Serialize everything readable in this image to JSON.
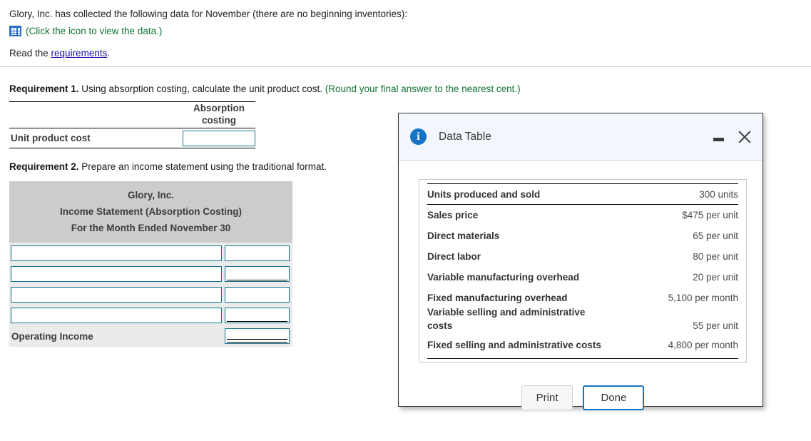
{
  "intro": {
    "line1": "Glory, Inc. has collected the following data for November (there are no beginning inventories):",
    "icon_name": "data-grid-icon",
    "icon_hint": "(Click the icon to view the data.)",
    "read_prefix": "Read the ",
    "read_link": "requirements",
    "read_suffix": "."
  },
  "requirement1": {
    "label": "Requirement 1.",
    "text": " Using absorption costing, calculate the unit product cost. ",
    "hint": "(Round your final answer to the nearest cent.)",
    "column_header_line1": "Absorption",
    "column_header_line2": "costing",
    "row_label": "Unit product cost",
    "input_value": ""
  },
  "requirement2": {
    "label": "Requirement 2.",
    "text": " Prepare an income statement using the traditional format.",
    "statement_header": [
      "Glory, Inc.",
      "Income Statement (Absorption Costing)",
      "For the Month Ended November 30"
    ],
    "rows": [
      {
        "label_value": "",
        "amount_value": "",
        "underline": "none"
      },
      {
        "label_value": "",
        "amount_value": "",
        "underline": "single"
      },
      {
        "label_value": "",
        "amount_value": "",
        "underline": "none"
      },
      {
        "label_value": "",
        "amount_value": "",
        "underline": "single"
      }
    ],
    "total_row": {
      "label": "Operating Income",
      "amount_value": "",
      "underline": "double"
    }
  },
  "dialog": {
    "title": "Data Table",
    "info_icon": "info-icon",
    "minimize_icon": "minimize-icon",
    "close_icon": "close-icon",
    "table": [
      {
        "label": "Units produced and sold",
        "value": "300 units"
      },
      {
        "label": "Sales price",
        "value": "$475 per unit"
      },
      {
        "label": "Direct materials",
        "value": "65 per unit"
      },
      {
        "label": "Direct labor",
        "value": "80 per unit"
      },
      {
        "label": "Variable manufacturing overhead",
        "value": "20 per unit"
      },
      {
        "label": "Fixed manufacturing overhead",
        "value": "5,100 per month"
      },
      {
        "label": "Variable selling and administrative costs",
        "value": "55 per unit"
      },
      {
        "label": "Fixed selling and administrative costs",
        "value": "4,800 per month"
      }
    ],
    "print_label": "Print",
    "done_label": "Done"
  },
  "colors": {
    "link": "#1a0dab",
    "hint_green": "#137333",
    "accent_blue": "#1673c4",
    "input_border": "#12718a",
    "header_gray": "#cccccc",
    "body_gray": "#ebebeb"
  }
}
